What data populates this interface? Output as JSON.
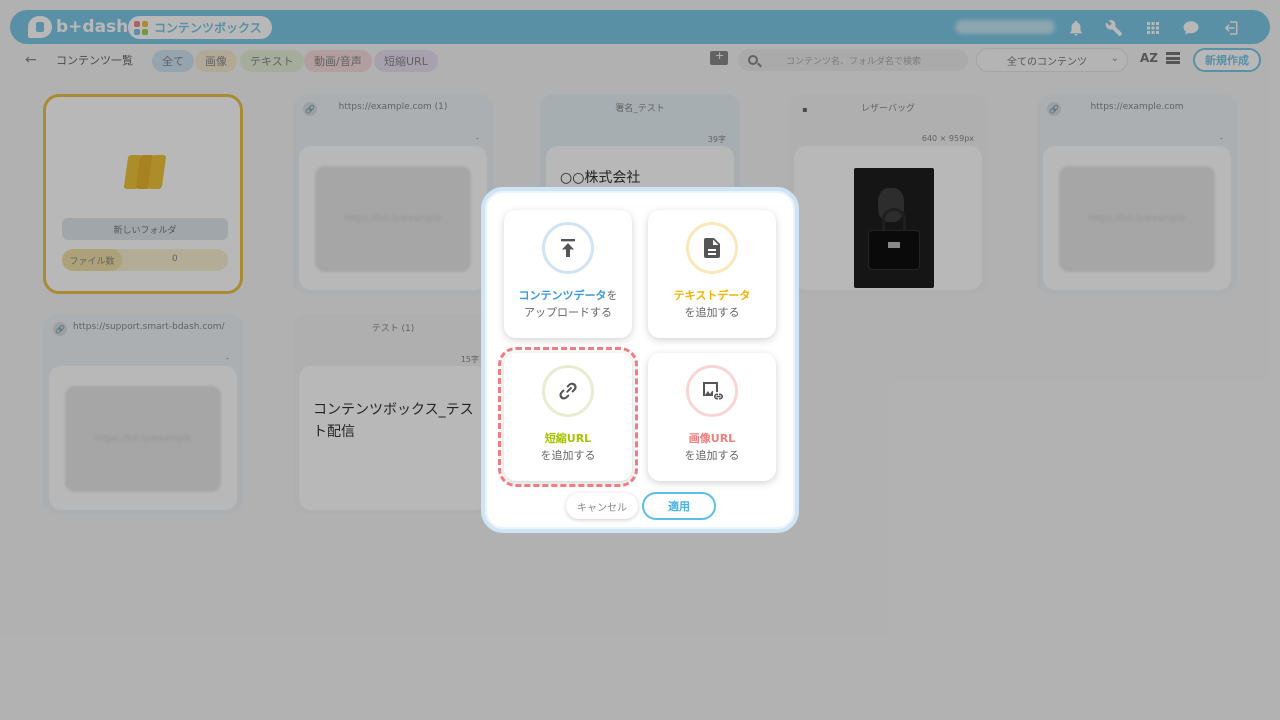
{
  "header": {
    "logo_text": "b+dash",
    "app_name": "コンテンツボックス",
    "icons": [
      "bell-icon",
      "wrench-icon",
      "apps-grid-icon",
      "chat-icon",
      "logout-icon"
    ]
  },
  "subbar": {
    "breadcrumb": "コンテンツ一覧",
    "tabs": [
      {
        "label": "全て",
        "color": "#cfe3f2"
      },
      {
        "label": "画像",
        "color": "#f5ead0"
      },
      {
        "label": "テキスト",
        "color": "#e7efd8"
      },
      {
        "label": "動画/音声",
        "color": "#f7dcdc"
      },
      {
        "label": "短縮URL",
        "color": "#e8e0f2"
      }
    ],
    "search_placeholder": "コンテンツ名、フォルダ名で検索",
    "filter_selected": "全てのコンテンツ",
    "sort_label": "AZ",
    "new_button": "新規作成"
  },
  "folder": {
    "name": "新しいフォルダ",
    "count_label": "ファイル数",
    "count": "0"
  },
  "cards": [
    {
      "title": "https://example.com (1)",
      "meta": "-",
      "thumb": "https://bit.ly/example"
    },
    {
      "title": "署名_テスト",
      "meta": "39字",
      "text": "○○株式会社"
    },
    {
      "title": "レザーバッグ",
      "meta": "640 × 959px"
    },
    {
      "title": "https://example.com",
      "meta": "-",
      "thumb": "https://bit.ly/example"
    },
    {
      "title": "https://support.smart-bdash.com/",
      "meta": "-",
      "thumb": "https://bit.ly/example"
    },
    {
      "title": "テスト (1)",
      "meta": "15字",
      "text": "コンテンツボックス_テスト配信"
    }
  ],
  "modal": {
    "tiles": [
      {
        "highlight": "コンテンツデータ",
        "rest": "を",
        "line2": "アップロードする",
        "color": "#3a9ad9",
        "ring": "#cfe3f2",
        "icon": "upload-icon"
      },
      {
        "highlight": "テキストデータ",
        "rest": "",
        "line2": "を追加する",
        "color": "#f0b400",
        "ring": "#fbe8b8",
        "icon": "document-icon"
      },
      {
        "highlight": "短縮URL",
        "rest": "",
        "line2": "を追加する",
        "color": "#a8c400",
        "ring": "#e9ecd2",
        "icon": "link-icon"
      },
      {
        "highlight": "画像URL",
        "rest": "",
        "line2": "を追加する",
        "color": "#f08080",
        "ring": "#f9d5d5",
        "icon": "image-link-icon"
      }
    ],
    "cancel_label": "キャンセル",
    "apply_label": "適用",
    "selected_tile": "短縮URL"
  }
}
